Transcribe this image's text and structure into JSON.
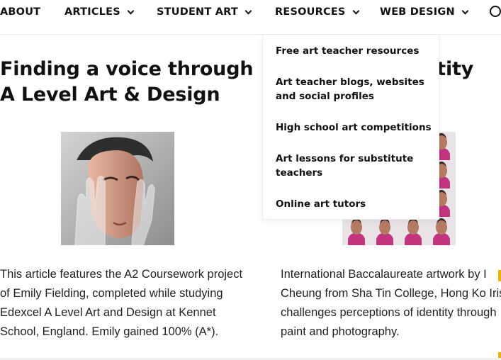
{
  "nav": {
    "items": [
      {
        "label": "ABOUT"
      },
      {
        "label": "ARTICLES"
      },
      {
        "label": "STUDENT ART"
      },
      {
        "label": "RESOURCES"
      },
      {
        "label": "WEB DESIGN"
      }
    ]
  },
  "dropdown": {
    "items": [
      {
        "label": "Free art teacher resources"
      },
      {
        "label": "Art teacher blogs, websites and social profiles"
      },
      {
        "label": "High school art competitions"
      },
      {
        "label": "Art lessons for substitute teachers"
      },
      {
        "label": "Online art tutors"
      }
    ]
  },
  "articles": [
    {
      "title": "Finding a voice through A Level Art & Design",
      "excerpt": "This article features the A2 Coursework project of Emily Fielding, completed while studying Edexcel A Level Art and Design at Kennet School, England. Emily gained 100% (A*)."
    },
    {
      "title": "dentity",
      "excerpt": "International Baccalaureate artwork by I Cheung from Sha Tin College, Hong Ko Iris challenges perceptions of identity through paint and photography."
    }
  ],
  "colors": {
    "accent": "#e8b400",
    "magenta": "#c2357d"
  }
}
